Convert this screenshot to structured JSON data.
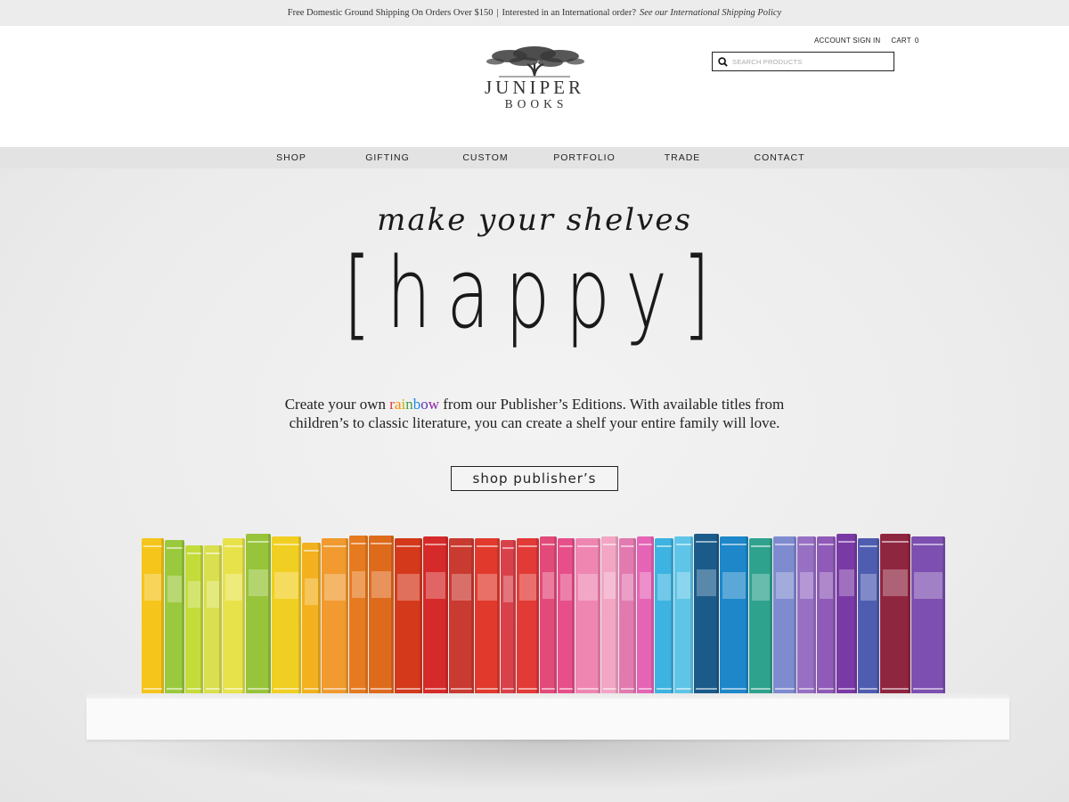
{
  "announcement": {
    "shipping": "Free Domestic Ground Shipping On Orders Over $150",
    "separator": "|",
    "international": "Interested in an International order?",
    "policy_link": "See our International Shipping Policy"
  },
  "header": {
    "logo_line1": "JUNIPER",
    "logo_line2": "BOOKS",
    "account_label": "ACCOUNT SIGN IN",
    "cart_label": "CART",
    "cart_count": "0",
    "search_placeholder": "SEARCH PRODUCTS"
  },
  "nav": {
    "items": [
      {
        "label": "SHOP"
      },
      {
        "label": "GIFTING"
      },
      {
        "label": "CUSTOM"
      },
      {
        "label": "PORTFOLIO"
      },
      {
        "label": "TRADE"
      },
      {
        "label": "CONTACT"
      }
    ]
  },
  "hero": {
    "tagline": "make your shelves",
    "headline": "[happy]",
    "intro_before": "Create your own",
    "intro_rainbow": [
      "r",
      "a",
      "i",
      "n",
      "b",
      "o",
      "w"
    ],
    "intro_after_line1": "from our Publisher’s Editions. With available titles from",
    "intro_line2": "children’s to classic literature, you can create a shelf your entire family will love.",
    "cta_label": "shop publisher’s"
  },
  "colors": {
    "books": [
      "#f5c51b",
      "#9bc93d",
      "#c3dc3a",
      "#d9df4e",
      "#e8e24a",
      "#97c43a",
      "#f1cf22",
      "#f3b11f",
      "#f09a2f",
      "#e67a1f",
      "#de6a1c",
      "#d4391c",
      "#d62a2a",
      "#c93a30",
      "#e13a2c",
      "#d9414a",
      "#e23a36",
      "#e24a7a",
      "#e64f8a",
      "#ef86b1",
      "#f2a6c4",
      "#e27ab0",
      "#e564b6",
      "#3cb3e0",
      "#5fc5e8",
      "#1b5b8a",
      "#1d87c9",
      "#2fa28e",
      "#7f8bcf",
      "#9770c4",
      "#8f5ab8",
      "#7a3aa6",
      "#4f5db0",
      "#8f2640",
      "#7d4fb0"
    ],
    "accent_text": "#222222",
    "nav_bg": "#e3e3e3"
  }
}
